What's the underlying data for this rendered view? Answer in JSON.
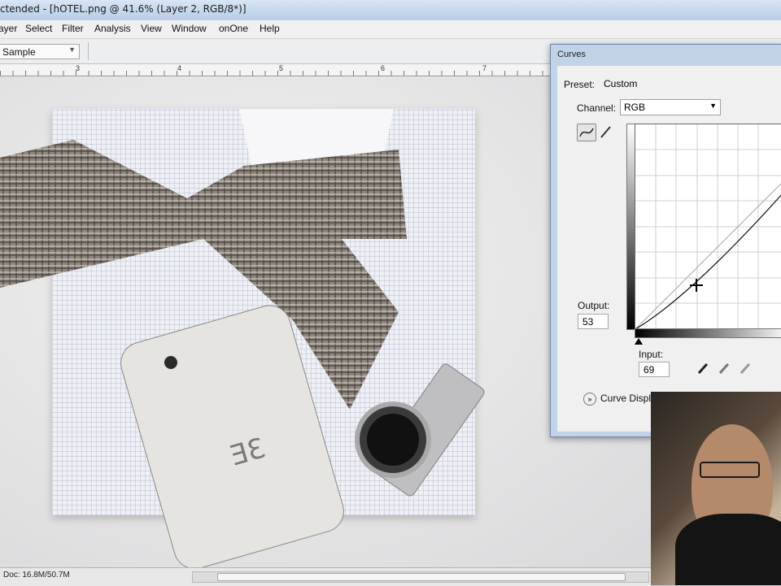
{
  "window": {
    "title": "ctended - [hOTEL.png @ 41.6% (Layer 2, RGB/8*)]"
  },
  "menu": [
    "ayer",
    "Select",
    "Filter",
    "Analysis",
    "View",
    "Window",
    "onOne",
    "Help"
  ],
  "options": {
    "sample_value": "Sample"
  },
  "ruler": {
    "labels": [
      "3",
      "4",
      "5",
      "6",
      "7"
    ]
  },
  "status": {
    "doc": "Doc: 16.8M/50.7M"
  },
  "curves": {
    "title": "Curves",
    "preset_label": "Preset:",
    "preset_value": "Custom",
    "channel_label": "Channel:",
    "channel_value": "RGB",
    "output_label": "Output:",
    "output_value": "53",
    "input_label": "Input:",
    "input_value": "69",
    "display_options": "Curve Displ",
    "control_point": {
      "input": 69,
      "output": 53
    }
  },
  "colors": {
    "accent": "#c2d3e8"
  }
}
